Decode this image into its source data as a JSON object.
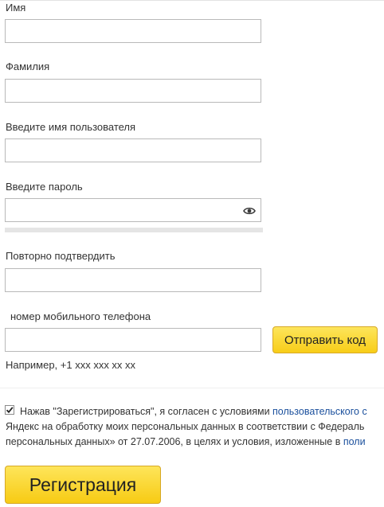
{
  "form": {
    "first_name": {
      "label": "Имя",
      "value": ""
    },
    "last_name": {
      "label": "Фамилия",
      "value": ""
    },
    "username": {
      "label": "Введите имя пользователя",
      "value": ""
    },
    "password": {
      "label": "Введите пароль",
      "value": "",
      "icon": "eye-icon"
    },
    "password_confirm": {
      "label": "Повторно подтвердить",
      "value": ""
    },
    "phone": {
      "label": "номер мобильного телефона",
      "value": "",
      "send_code_label": "Отправить код",
      "hint": "Например, +1 xxx xxx xx xx"
    }
  },
  "consent": {
    "checked": true,
    "line1_text": "Нажав \"Зарегистрироваться\", я согласен с условиями ",
    "line1_link": "пользовательского с",
    "line2_text": "Яндекс на обработку моих персональных данных в соответствии с Федераль",
    "line3_text": "персональных данных» от 27.07.2006, в целях и условия, изложенные в ",
    "line3_link": "поли"
  },
  "register_label": "Регистрация",
  "colors": {
    "button_yellow": "#f8cd18",
    "link_blue": "#1a4f9c",
    "input_border": "#b9b9b9"
  }
}
